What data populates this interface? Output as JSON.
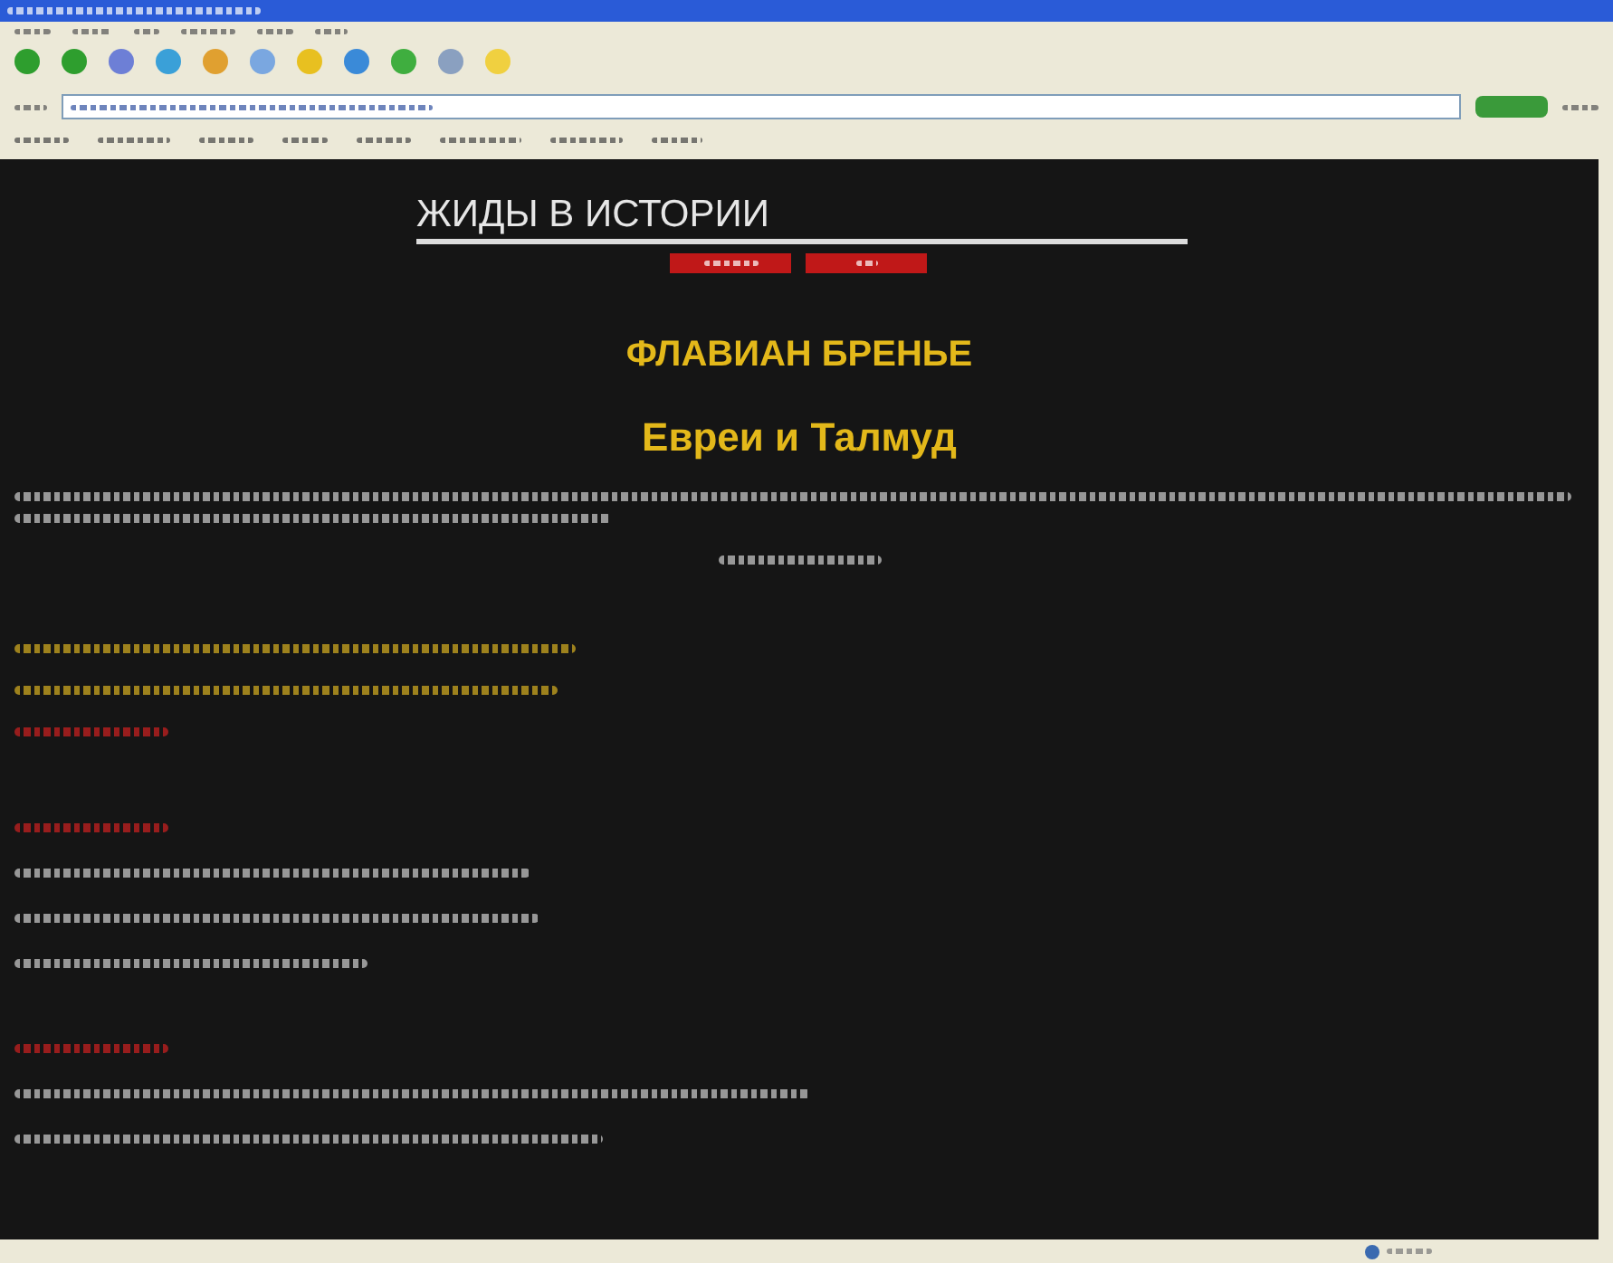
{
  "page": {
    "site_title": "ЖИДЫ В ИСТОРИИ",
    "author": "ФЛАВИАН БРЕНЬЕ",
    "book_title": "Евреи и Талмуд"
  }
}
